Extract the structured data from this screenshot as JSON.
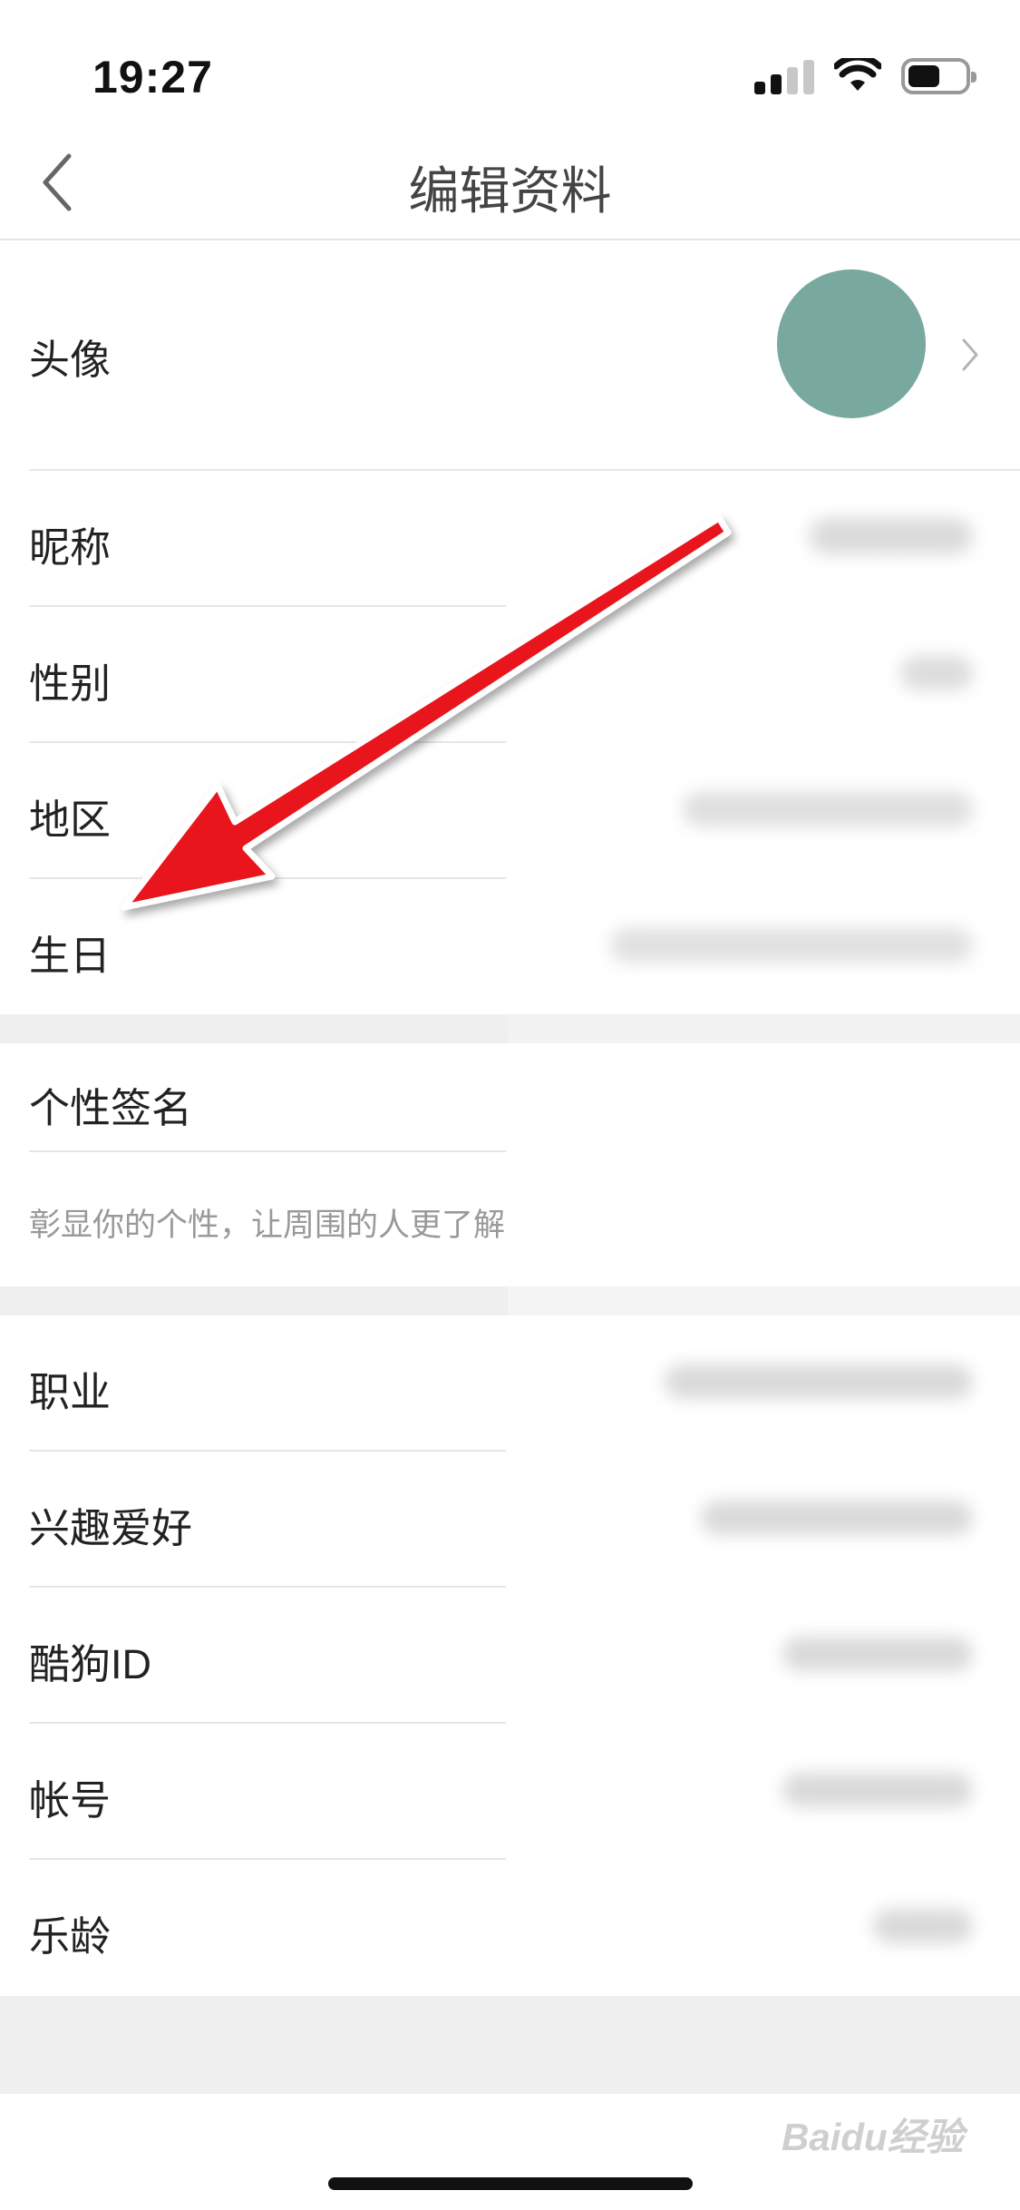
{
  "status_bar": {
    "time": "19:27"
  },
  "nav": {
    "title": "编辑资料"
  },
  "profile": {
    "avatar_label": "头像",
    "avatar_color": "#79a89e",
    "nickname_label": "昵称",
    "gender_label": "性别",
    "region_label": "地区",
    "birthday_label": "生日",
    "signature_label": "个性签名",
    "signature_placeholder": "彰显你的个性，让周围的人更了解",
    "occupation_label": "职业",
    "hobbies_label": "兴趣爱好",
    "kugou_id_label": "酷狗ID",
    "account_label": "帐号",
    "music_age_label": "乐龄"
  },
  "annotation": {
    "arrow_color": "#e8141b"
  },
  "watermark": {
    "text": "Baidu经验"
  }
}
